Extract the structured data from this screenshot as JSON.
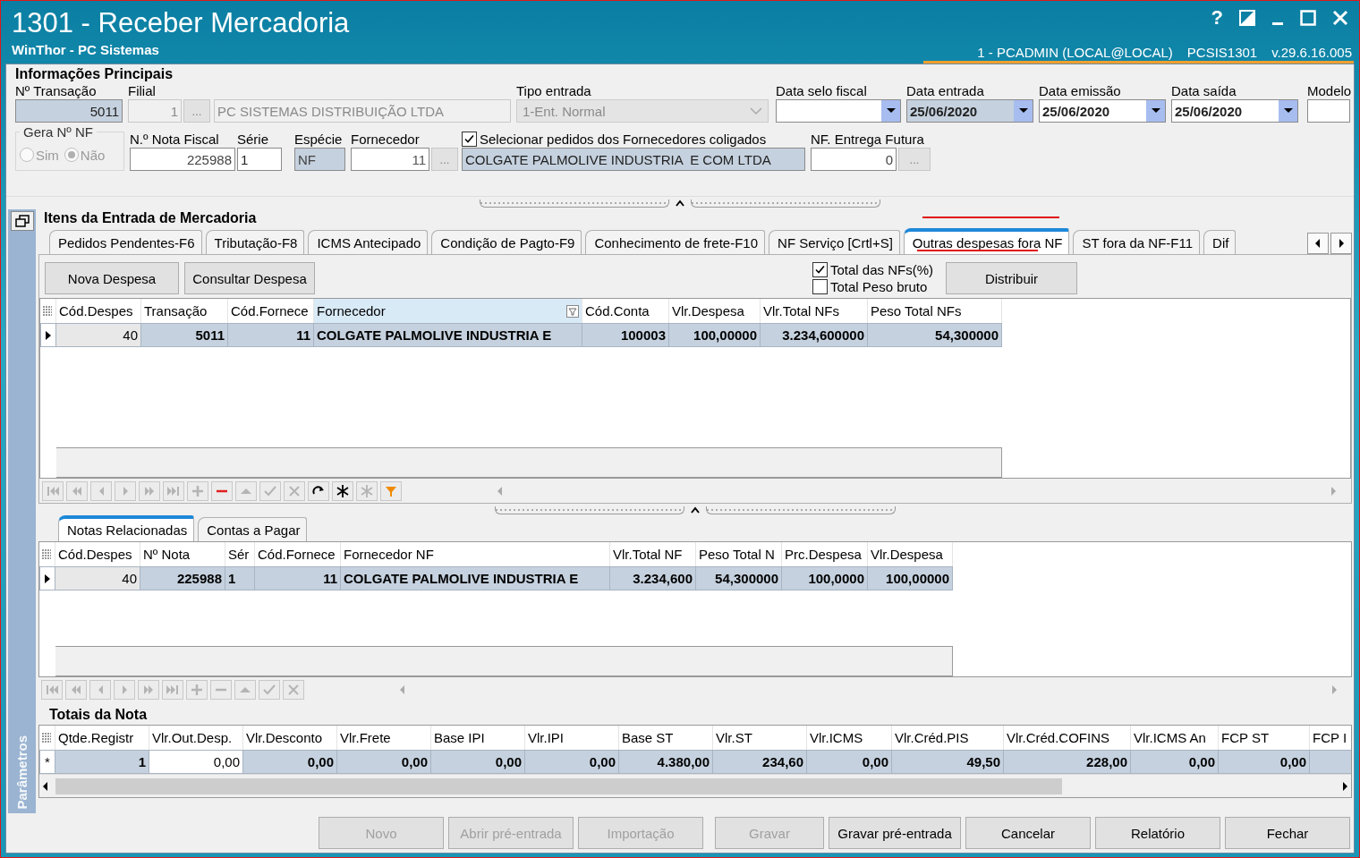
{
  "window": {
    "title": "1301 - Receber Mercadoria",
    "subtitle": "WinThor - PC Sistemas",
    "help": "?",
    "user_info": "1 - PCADMIN (LOCAL@LOCAL)",
    "program": "PCSIS1301",
    "version": "v.29.6.16.005"
  },
  "main_info": {
    "title": "Informações Principais",
    "transacao": {
      "label": "Nº Transação",
      "value": "5011",
      "readonly": true
    },
    "filial": {
      "label": "Filial",
      "code": "1",
      "button": "...",
      "name": "PC SISTEMAS DISTRIBUIÇÃO LTDA",
      "disabled": true
    },
    "tipo_entrada": {
      "label": "Tipo entrada",
      "value": "1-Ent. Normal",
      "disabled": true
    },
    "dates": [
      {
        "label": "Data selo fiscal",
        "readonly": false
      },
      {
        "label": "Data entrada",
        "value": "25/06/2020",
        "readonly": true
      },
      {
        "label": "Data emissão",
        "value": "25/06/2020",
        "readonly": false
      },
      {
        "label": "Data saída",
        "value": "25/06/2020",
        "readonly": false
      }
    ],
    "modelo": {
      "label": "Modelo"
    },
    "gera_nf": {
      "label": "Gera Nº NF",
      "disabled": true,
      "options": [
        {
          "label": "Sim",
          "selected": false
        },
        {
          "label": "Não",
          "selected": true
        }
      ]
    },
    "nota_fiscal": {
      "label": "N.º Nota Fiscal",
      "value": "225988"
    },
    "serie": {
      "label": "Série",
      "value": "1"
    },
    "especie": {
      "label": "Espécie",
      "value": "NF",
      "readonly": true
    },
    "fornecedor": {
      "label": "Fornecedor",
      "code": "11",
      "button": "...",
      "name": "COLGATE PALMOLIVE INDUSTRIA  E COM LTDA"
    },
    "coligados": {
      "label": "Selecionar pedidos dos Fornecedores coligados",
      "checked": true
    },
    "entrega_futura": {
      "label": "NF. Entrega Futura",
      "value": "0",
      "button": "..."
    }
  },
  "side_panel": {
    "label": "Parâmetros"
  },
  "items": {
    "title": "Itens da Entrada de Mercadoria",
    "tabs": [
      {
        "label": "Pedidos Pendentes-F6",
        "selected": false
      },
      {
        "label": "Tributação-F8",
        "selected": false
      },
      {
        "label": "ICMS Antecipado",
        "selected": false
      },
      {
        "label": "Condição de Pagto-F9",
        "selected": false
      },
      {
        "label": "Conhecimento de frete-F10",
        "selected": false
      },
      {
        "label": "NF Serviço [Crtl+S]",
        "selected": false
      },
      {
        "label": "Outras despesas fora NF",
        "selected": true,
        "annotated": true
      },
      {
        "label": "ST fora da NF-F11",
        "selected": false
      },
      {
        "label": "Dif",
        "selected": false
      }
    ],
    "buttons": [
      "Nova Despesa",
      "Consultar Despesa"
    ],
    "options": [
      {
        "label": "Total das NFs(%)",
        "checked": true
      },
      {
        "label": "Total Peso bruto",
        "checked": false
      }
    ],
    "distribute": "Distribuir",
    "grid": {
      "columns": [
        {
          "label": "Cód.Despes",
          "numeric": true
        },
        {
          "label": "Transação",
          "numeric": true
        },
        {
          "label": "Cód.Fornece",
          "numeric": true
        },
        {
          "label": "Fornecedor",
          "numeric": false,
          "filter": true
        },
        {
          "label": "Cód.Conta",
          "numeric": true
        },
        {
          "label": "Vlr.Despesa",
          "numeric": true
        },
        {
          "label": "Vlr.Total NFs",
          "numeric": true
        },
        {
          "label": "Peso Total NFs",
          "numeric": true
        }
      ],
      "rows": [
        {
          "selected": true,
          "cells": [
            "40",
            "5011",
            "11",
            "COLGATE PALMOLIVE INDUSTRIA  E",
            "100003",
            "100,00000",
            "3.234,600000",
            "54,300000"
          ],
          "focused": [
            true,
            false,
            false,
            false,
            false,
            false,
            false,
            false
          ]
        }
      ]
    },
    "nav": [
      {
        "kind": "first",
        "enabled": false
      },
      {
        "kind": "prior_page",
        "enabled": false
      },
      {
        "kind": "prior",
        "enabled": false
      },
      {
        "kind": "next",
        "enabled": false
      },
      {
        "kind": "next_page",
        "enabled": false
      },
      {
        "kind": "last",
        "enabled": false
      },
      {
        "kind": "insert",
        "enabled": false
      },
      {
        "kind": "delete",
        "enabled": true
      },
      {
        "kind": "edit",
        "enabled": false
      },
      {
        "kind": "post",
        "enabled": false
      },
      {
        "kind": "cancel",
        "enabled": false
      },
      {
        "kind": "refresh",
        "enabled": true
      },
      {
        "kind": "star",
        "enabled": true
      },
      {
        "kind": "star",
        "enabled": false
      },
      {
        "kind": "filter",
        "enabled": true
      }
    ],
    "subtabs": [
      {
        "label": "Notas Relacionadas",
        "selected": true
      },
      {
        "label": "Contas a Pagar",
        "selected": false
      }
    ],
    "grid2": {
      "columns": [
        {
          "label": "Cód.Despes",
          "numeric": true
        },
        {
          "label": "Nº Nota",
          "numeric": true
        },
        {
          "label": "Sér",
          "numeric": false
        },
        {
          "label": "Cód.Fornece",
          "numeric": true
        },
        {
          "label": "Fornecedor NF",
          "numeric": false
        },
        {
          "label": "Vlr.Total NF",
          "numeric": true
        },
        {
          "label": "Peso Total N",
          "numeric": true
        },
        {
          "label": "Prc.Despesa",
          "numeric": true
        },
        {
          "label": "Vlr.Despesa",
          "numeric": true
        }
      ],
      "rows": [
        {
          "selected": true,
          "cells": [
            "40",
            "225988",
            "1",
            "11",
            "COLGATE PALMOLIVE INDUSTRIA  E",
            "3.234,600",
            "54,300000",
            "100,0000",
            "100,00000"
          ],
          "focused": [
            true,
            false,
            false,
            false,
            false,
            false,
            false,
            false,
            false
          ]
        }
      ]
    },
    "nav2": [
      {
        "kind": "first",
        "enabled": false
      },
      {
        "kind": "prior_page",
        "enabled": false
      },
      {
        "kind": "prior",
        "enabled": false
      },
      {
        "kind": "next",
        "enabled": false
      },
      {
        "kind": "next_page",
        "enabled": false
      },
      {
        "kind": "last",
        "enabled": false
      },
      {
        "kind": "insert",
        "enabled": false
      },
      {
        "kind": "delete",
        "enabled": false
      },
      {
        "kind": "edit",
        "enabled": false
      },
      {
        "kind": "post",
        "enabled": false
      },
      {
        "kind": "cancel",
        "enabled": false
      }
    ]
  },
  "totals": {
    "title": "Totais da Nota",
    "marker": "*",
    "columns": [
      "Qtde.Registr",
      "Vlr.Out.Desp.",
      "Vlr.Desconto",
      "Vlr.Frete",
      "Base IPI",
      "Vlr.IPI",
      "Base ST",
      "Vlr.ST",
      "Vlr.ICMS",
      "Vlr.Créd.PIS",
      "Vlr.Créd.COFINS",
      "Vlr.ICMS An",
      "FCP ST",
      "FCP I"
    ],
    "row": {
      "selected": true,
      "cells": [
        "1",
        "0,00",
        "0,00",
        "0,00",
        "0,00",
        "0,00",
        "4.380,00",
        "234,60",
        "0,00",
        "49,50",
        "228,00",
        "0,00",
        "0,00",
        ""
      ],
      "focused": [
        false,
        true,
        false,
        false,
        false,
        false,
        false,
        false,
        false,
        false,
        false,
        false,
        false,
        false
      ]
    }
  },
  "footer_buttons": [
    {
      "label": "Novo",
      "disabled": true
    },
    {
      "label": "Abrir pré-entrada",
      "disabled": true
    },
    {
      "label": "Importação",
      "disabled": true
    },
    {
      "label": "Gravar",
      "disabled": true
    },
    {
      "label": "Gravar pré-entrada",
      "disabled": false
    },
    {
      "label": "Cancelar",
      "disabled": false
    },
    {
      "label": "Relatório",
      "disabled": false
    },
    {
      "label": "Fechar",
      "disabled": false
    }
  ]
}
